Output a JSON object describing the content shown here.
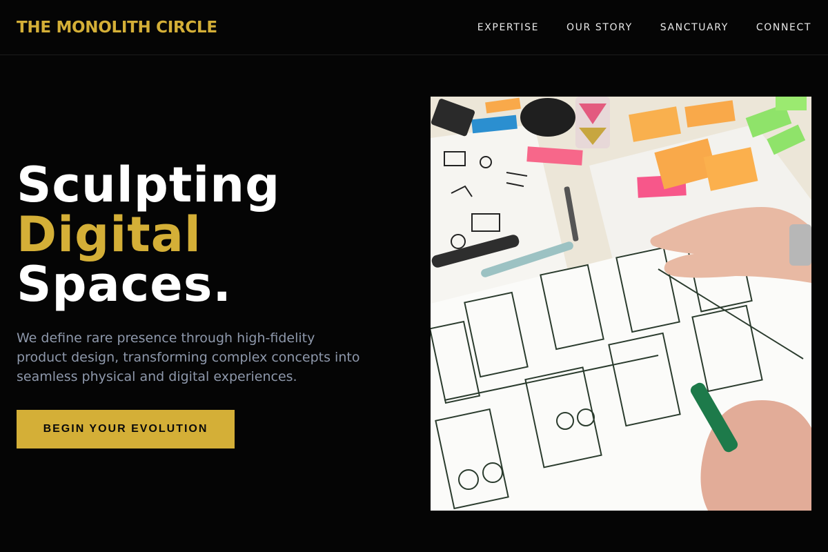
{
  "header": {
    "brand": "THE MONOLITH CIRCLE",
    "nav": [
      {
        "label": "EXPERTISE"
      },
      {
        "label": "OUR STORY"
      },
      {
        "label": "SANCTUARY"
      },
      {
        "label": "CONNECT"
      }
    ]
  },
  "hero": {
    "headline": {
      "line1": "Sculpting",
      "line2": "Digital",
      "line3": "Spaces."
    },
    "lede": "We define rare presence through high-fidelity product design, transforming complex concepts into seamless physical and digital experiences.",
    "cta_label": "BEGIN YOUR EVOLUTION",
    "image_subject": "photo of hand-drawn UI wireframe sketches, sticky notes and markers on a table"
  },
  "colors": {
    "background": "#050505",
    "accent": "#d4af37",
    "text_primary": "#ffffff",
    "text_muted": "#8e98ab"
  }
}
